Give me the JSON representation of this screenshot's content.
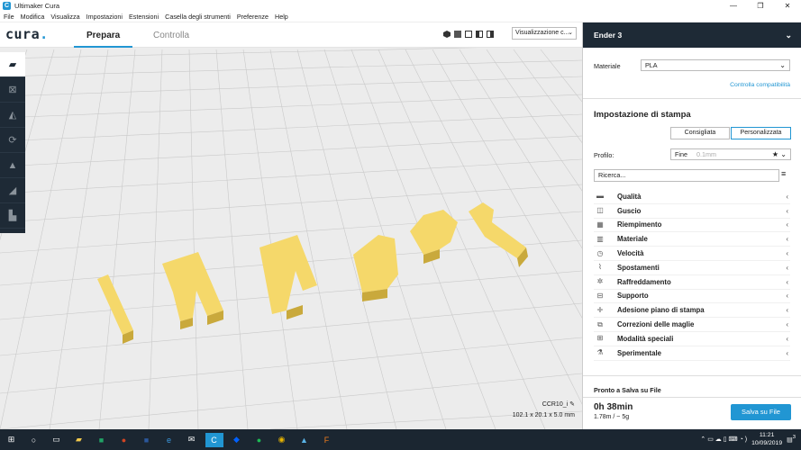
{
  "titlebar": {
    "title": "Ultimaker Cura",
    "minimize": "—",
    "maximize": "❐",
    "close": "✕"
  },
  "menu": [
    "File",
    "Modifica",
    "Visualizza",
    "Impostazioni",
    "Estensioni",
    "Casella degli strumenti",
    "Preferenze",
    "Help"
  ],
  "header": {
    "logo_text": "cura",
    "logo_dot": ".",
    "tab_prepare": "Prepara",
    "tab_monitor": "Controlla",
    "view_select": "Visualizzazione c..."
  },
  "tools": [
    "folder-open-icon",
    "move-icon",
    "scale-icon",
    "rotate-icon",
    "mirror-icon",
    "per-model-settings-icon",
    "support-blocker-icon"
  ],
  "scene": {
    "model_text": "Impact"
  },
  "object_info": {
    "name": "CCR10_i",
    "dims": "102.1 x 20.1 x 5.0 mm"
  },
  "panel": {
    "printer": "Ender 3",
    "material_label": "Materiale",
    "material_value": "PLA",
    "compat_link": "Controlla compatibilità",
    "print_settings_title": "Impostazione di stampa",
    "mode_recommended": "Consigliata",
    "mode_custom": "Personalizzata",
    "profile_label": "Profilo:",
    "profile_value": "Fine",
    "profile_hint": "0.1mm",
    "search_placeholder": "Ricerca...",
    "categories": [
      {
        "icon": "quality-icon",
        "label": "Qualità"
      },
      {
        "icon": "shell-icon",
        "label": "Guscio"
      },
      {
        "icon": "infill-icon",
        "label": "Riempimento"
      },
      {
        "icon": "material-icon",
        "label": "Materiale"
      },
      {
        "icon": "speed-icon",
        "label": "Velocità"
      },
      {
        "icon": "travel-icon",
        "label": "Spostamenti"
      },
      {
        "icon": "cooling-icon",
        "label": "Raffreddamento"
      },
      {
        "icon": "support-icon",
        "label": "Supporto"
      },
      {
        "icon": "adhesion-icon",
        "label": "Adesione piano di stampa"
      },
      {
        "icon": "mesh-fixes-icon",
        "label": "Correzioni delle maglie"
      },
      {
        "icon": "special-modes-icon",
        "label": "Modalità speciali"
      },
      {
        "icon": "experimental-icon",
        "label": "Sperimentale"
      }
    ],
    "ready_label": "Pronto a Salva su File",
    "time": "0h 38min",
    "material_usage": "1.78m / ~ 5g",
    "save_button": "Salva su File"
  },
  "taskbar": {
    "time": "11:21",
    "date": "10/09/2019",
    "notif": "3",
    "apps": [
      "windows-start-icon",
      "search-icon",
      "task-view-icon",
      "file-explorer-icon",
      "excel-icon",
      "powerpoint-icon",
      "word-icon",
      "edge-icon",
      "mail-icon",
      "cura-icon",
      "dropbox-icon",
      "spotify-icon",
      "chrome-icon",
      "app-icon",
      "fusion-icon"
    ]
  },
  "colors": {
    "accent": "#2196d3",
    "dark": "#1e2a36",
    "model": "#f5d86a"
  }
}
